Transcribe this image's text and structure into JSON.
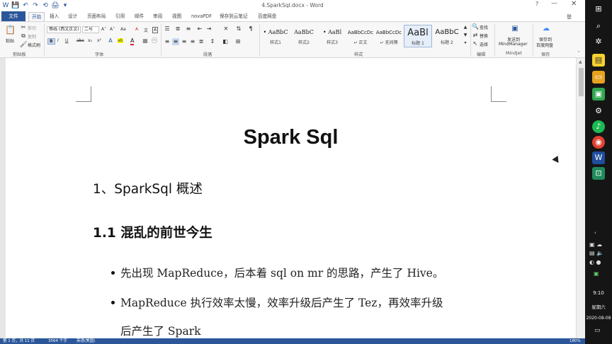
{
  "window": {
    "title": "4.SparkSql.docx - Word",
    "help": "?",
    "minimize": "—",
    "close": "✕"
  },
  "quick_access": [
    "💾",
    "↶",
    "↷",
    "⟲",
    "🖨",
    "▾"
  ],
  "tabs": [
    {
      "label": "文件"
    },
    {
      "label": "开始"
    },
    {
      "label": "插入"
    },
    {
      "label": "设计"
    },
    {
      "label": "页面布局"
    },
    {
      "label": "引用"
    },
    {
      "label": "邮件"
    },
    {
      "label": "审阅"
    },
    {
      "label": "视图"
    },
    {
      "label": "novaPDF"
    },
    {
      "label": "保存到云笔记"
    },
    {
      "label": "百度网盘"
    }
  ],
  "sign_in": "登",
  "ribbon": {
    "clipboard": {
      "paste": "粘贴",
      "cut": "剪切",
      "copy": "复制",
      "format_painter": "格式刷",
      "label": "剪贴板"
    },
    "font": {
      "font_name": "等线 (西文正文)",
      "font_size": "二号",
      "label": "字体",
      "bold": "B",
      "italic": "I",
      "underline": "U",
      "strike": "abc",
      "sub": "x₂",
      "sup": "x²",
      "grow": "A˄",
      "shrink": "A˅",
      "case": "Aa",
      "clear": "A",
      "highlight": "ab",
      "color": "A",
      "wen": "文",
      "border": "A"
    },
    "paragraph": {
      "label": "段落"
    },
    "styles": {
      "label": "样式",
      "items": [
        {
          "sample": "• AaBbC",
          "name": "样式1"
        },
        {
          "sample": "AaBbC",
          "name": "样式2"
        },
        {
          "sample": "• AaBl",
          "name": "样式3"
        },
        {
          "sample": "AaBbCcDc",
          "name": "↵ 正文"
        },
        {
          "sample": "AaBbCcDc",
          "name": "↵ 无间隔"
        },
        {
          "sample": "AaBl",
          "name": "标题 1"
        },
        {
          "sample": "AaBbC",
          "name": "标题 2"
        }
      ]
    },
    "editing": {
      "find": "查找",
      "replace": "替换",
      "select": "选择",
      "label": "编辑"
    },
    "mindjet": {
      "line1": "发送到",
      "line2": "MindManager",
      "label": "Mindjet"
    },
    "save": {
      "line1": "保存到",
      "line2": "百度网盘",
      "label": "保存"
    }
  },
  "document": {
    "title": "Spark Sql",
    "heading1": "1、SparkSql 概述",
    "heading2": "1.1 混乱的前世今生",
    "bullets": [
      "先出现 MapReduce，后本着 sql on mr 的思路，产生了 Hive。",
      "MapReduce 执行效率太慢，效率升级后产生了 Tez，再效率升级",
      "后产生了 Spark"
    ]
  },
  "status": {
    "page": "第 1 页，共 11 页",
    "words": "3564 个字",
    "lang": "英语(美国)",
    "zoom": "180%"
  },
  "taskbar": {
    "time": "9:10",
    "day": "星期六",
    "date": "2020-08-08"
  }
}
